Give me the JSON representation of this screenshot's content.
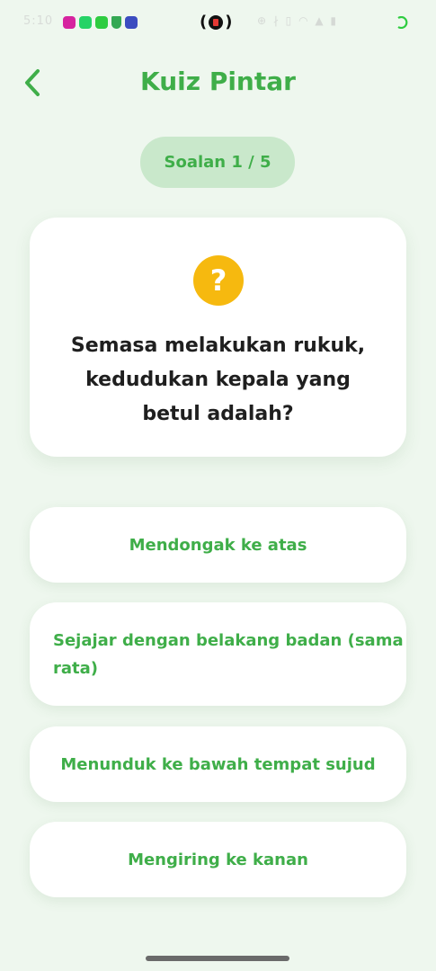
{
  "status_bar": {
    "time": "5:10"
  },
  "header": {
    "title": "Kuiz Pintar",
    "back_icon": "chevron-left-icon"
  },
  "counter": {
    "label": "Soalan 1 / 5"
  },
  "question": {
    "icon": "question-mark-icon",
    "text": "Semasa melakukan rukuk, kedudukan kepala yang betul adalah?"
  },
  "options": [
    {
      "label": "Mendongak ke atas"
    },
    {
      "label": "Sejajar dengan belakang badan (sama rata)"
    },
    {
      "label": "Menunduk ke bawah tempat sujud"
    },
    {
      "label": "Mengiring ke kanan"
    }
  ],
  "colors": {
    "accent": "#3fae49",
    "background": "#eef7ee",
    "counter_bg": "#c9e8cb",
    "question_icon": "#f6b90f"
  }
}
